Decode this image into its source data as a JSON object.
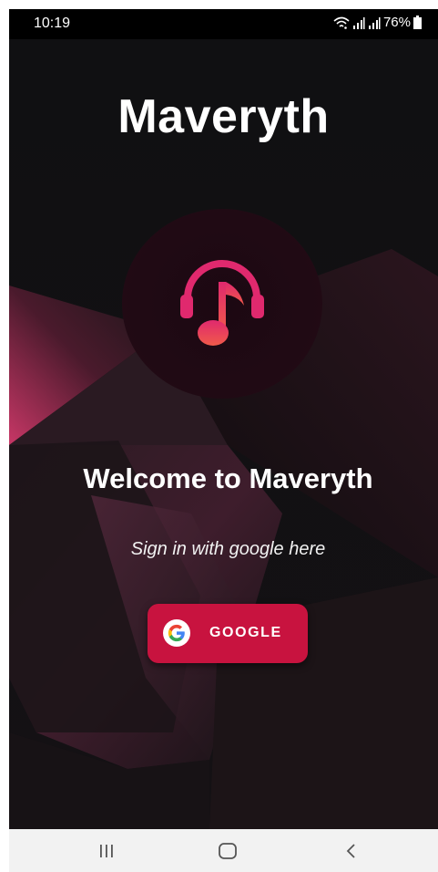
{
  "status_bar": {
    "time": "10:19",
    "battery": "76%",
    "icons": [
      "wifi-icon",
      "signal-icon",
      "signal-icon",
      "battery-icon"
    ]
  },
  "app": {
    "title": "Maveryth",
    "logo_icon": "headphones-music-note-icon"
  },
  "welcome": {
    "heading": "Welcome to Maveryth",
    "subtitle": "Sign in with google here"
  },
  "google_button": {
    "label": "GOOGLE",
    "icon": "google-icon"
  },
  "nav_bar": {
    "items": [
      "recents-icon",
      "home-icon",
      "back-icon"
    ]
  },
  "colors": {
    "accent": "#c8133f",
    "pink": "#e0296e",
    "background": "#131114",
    "nav_bar": "#f2f2f2"
  }
}
